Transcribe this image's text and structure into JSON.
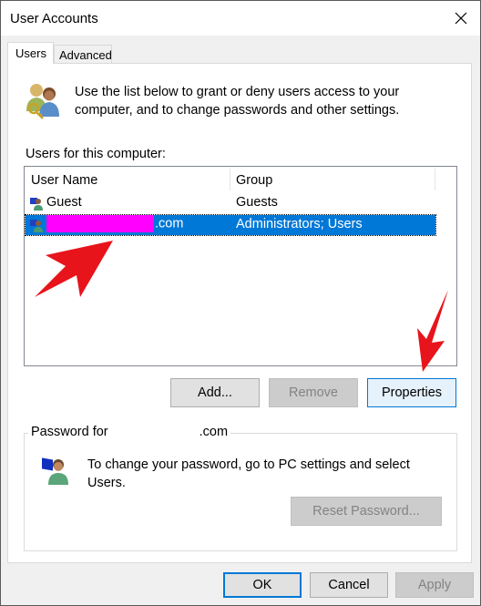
{
  "window": {
    "title": "User Accounts",
    "close_icon": "close-icon"
  },
  "tabs": [
    {
      "label": "Users",
      "active": true
    },
    {
      "label": "Advanced",
      "active": false
    }
  ],
  "intro": {
    "icon": "users-key-icon",
    "text": "Use the list below to grant or deny users access to your computer, and to change passwords and other settings."
  },
  "users_list": {
    "label": "Users for this computer:",
    "columns": [
      "User Name",
      "Group"
    ],
    "rows": [
      {
        "icon": "user-icon",
        "name": "Guest",
        "group": "Guests",
        "selected": false
      },
      {
        "icon": "user-icon",
        "name": ".com",
        "name_redacted": true,
        "group": "Administrators; Users",
        "selected": true
      }
    ],
    "redaction_color": "#ff00ff",
    "selection_color": "#0078d7"
  },
  "list_buttons": {
    "add": "Add...",
    "remove": "Remove",
    "properties": "Properties"
  },
  "password_group": {
    "legend_prefix": "Password for",
    "legend_suffix": ".com",
    "icon": "user-computer-icon",
    "text": "To change your password, go to PC settings and select Users.",
    "reset_button": "Reset Password..."
  },
  "footer_buttons": {
    "ok": "OK",
    "cancel": "Cancel",
    "apply": "Apply"
  },
  "annotations": {
    "arrow_color": "#e8141b",
    "arrows": [
      "arrow-to-selected-user",
      "arrow-to-properties"
    ]
  }
}
